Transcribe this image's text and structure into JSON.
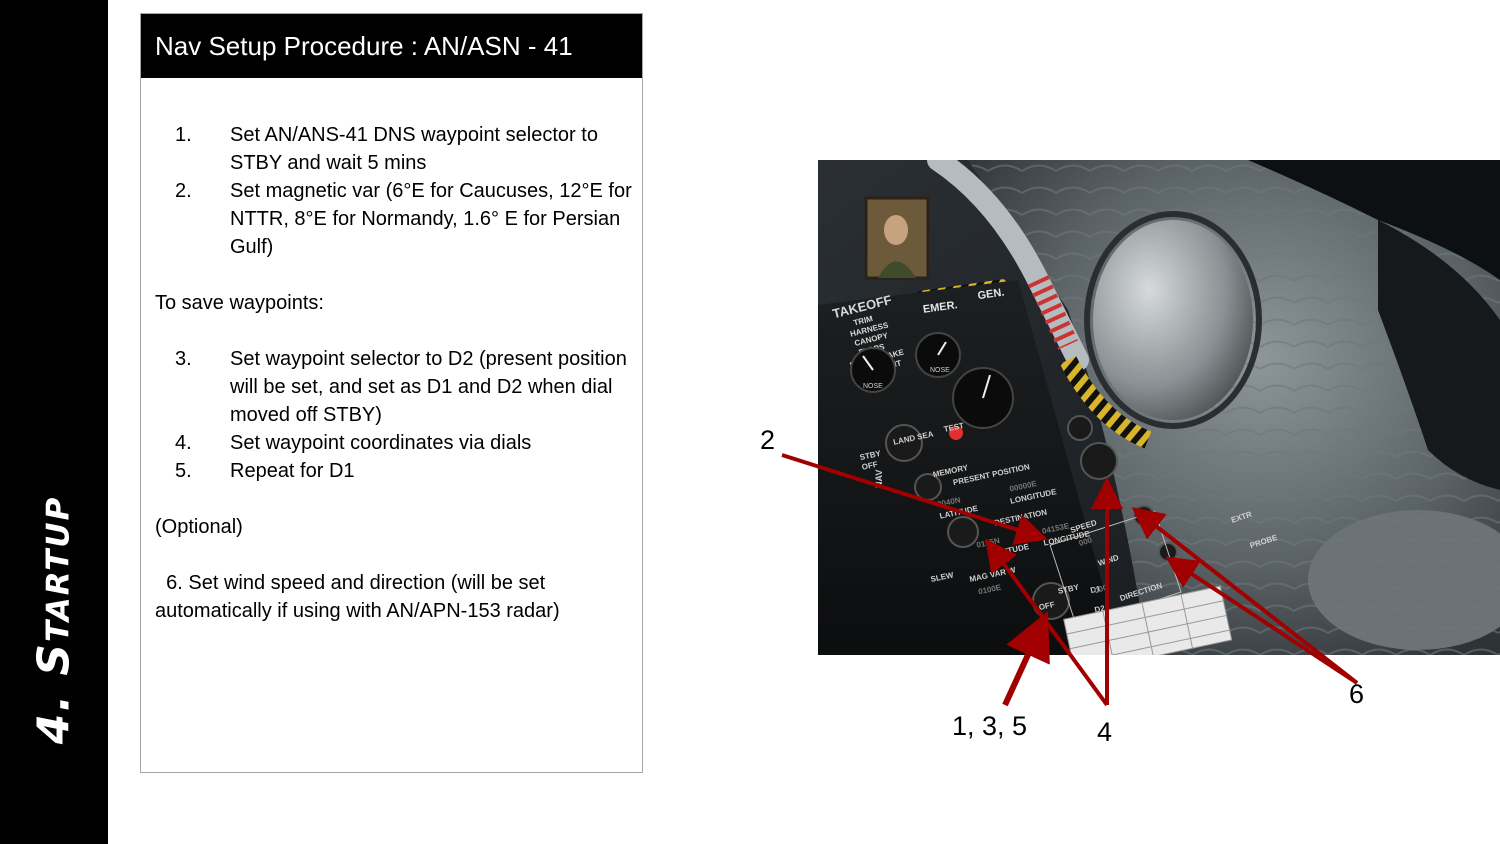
{
  "sidebar": {
    "section_title": "4. Startup"
  },
  "panel": {
    "title": "Nav Setup Procedure : AN/ASN - 41",
    "steps_a": [
      {
        "num": "1.",
        "text": "Set AN/ANS-41 DNS waypoint selector to STBY and wait 5 mins"
      },
      {
        "num": "2.",
        "text": "Set magnetic var (6°E for Caucuses, 12°E for NTTR, 8°E for Normandy, 1.6° E for Persian Gulf)"
      }
    ],
    "save_heading": "To save waypoints:",
    "steps_b": [
      {
        "num": "3.",
        "text": "Set waypoint selector to D2 (present position will be set, and set as D1 and D2 when dial moved off STBY)"
      },
      {
        "num": "4.",
        "text": "Set waypoint coordinates via dials"
      },
      {
        "num": "5.",
        "text": "Repeat for D1"
      }
    ],
    "optional_heading": "(Optional)",
    "optional_step": "  6. Set wind speed and direction (will be set automatically if using with AN/APN-153 radar)"
  },
  "photo": {
    "panel_labels": {
      "takeoff": "TAKEOFF",
      "trim": "TRIM",
      "harness": "HARNESS",
      "canopy": "CANOPY",
      "flaps": "FLAPS",
      "speedbrake": "SPEEDBRAKE",
      "armament": "ARMAMENT",
      "emer": "EMER.",
      "gen": "GEN.",
      "nose1": "NOSE",
      "nose2": "NOSE",
      "land_sea": "LAND SEA",
      "test": "TEST",
      "stby": "STBY",
      "off": "OFF",
      "nav": "NAV",
      "memory": "MEMORY",
      "present_position": "PRESENT POSITION",
      "pp_lat_val": "0040N",
      "pp_lon_val": "00000E",
      "latitude": "LATITUDE",
      "longitude": "LONGITUDE",
      "destination": "DESTINATION",
      "dest_lat_val": "0155N",
      "dest_lon_val": "04153E",
      "mag_var": "MAG VAR W",
      "mag_val": "0100E",
      "speed": "SPEED",
      "speed_val": "000",
      "wind": "WIND",
      "dir_val": "000",
      "direction": "DIRECTION",
      "slew": "SLEW",
      "d1": "D1",
      "d2": "D2",
      "extr": "EXTR",
      "probe": "PROBE"
    }
  },
  "callouts": {
    "label_2": "2",
    "label_135": "1, 3, 5",
    "label_4": "4",
    "label_6": "6",
    "arrow_color": "#a00000"
  }
}
